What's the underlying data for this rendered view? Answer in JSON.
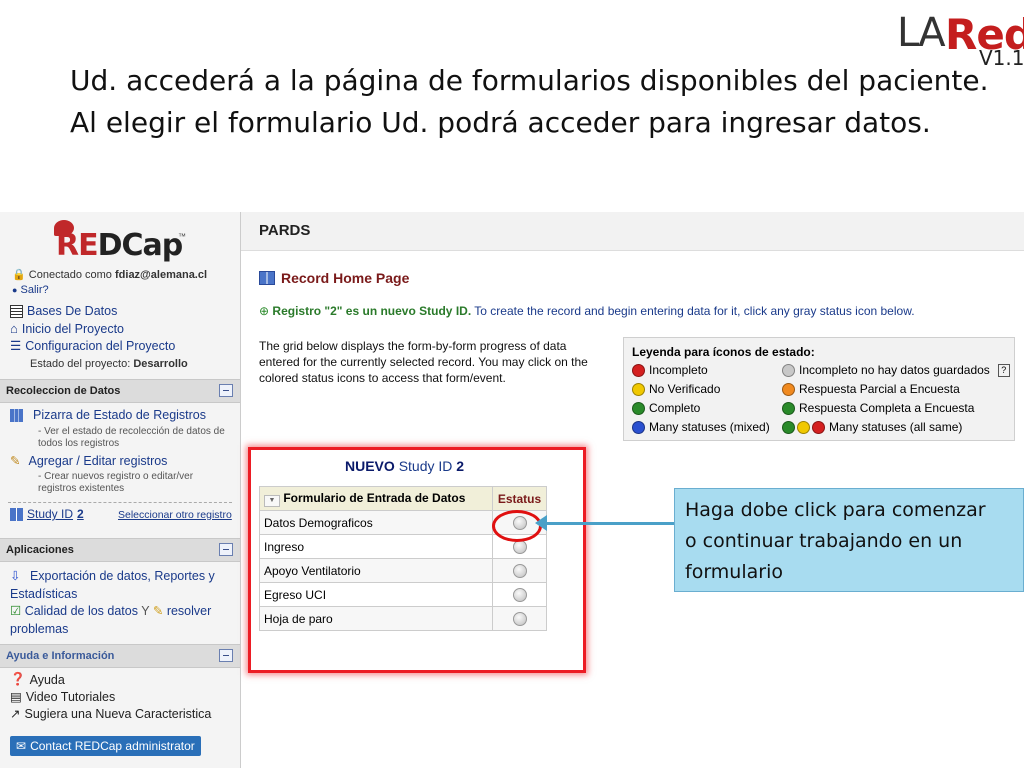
{
  "slide": {
    "title_line1": "Ud. accederá a la página de formularios disponibles del paciente.",
    "title_line2": "Al elegir el formulario Ud. podrá acceder para ingresar datos.",
    "logo_la": "LA",
    "logo_red": "Red",
    "logo_version": "V1.1"
  },
  "sidebar": {
    "logo_text_r": "RE",
    "logo_text_rest": "DCap",
    "logo_tm": "™",
    "connected_as_label": "Conectado como",
    "user": "fdiaz@alemana.cl",
    "logout": "Salir?",
    "links": [
      {
        "label": "Bases De Datos"
      },
      {
        "label": "Inicio del Proyecto"
      },
      {
        "label": "Configuracion del Proyecto"
      }
    ],
    "project_status_label": "Estado del proyecto:",
    "project_status": "Desarrollo",
    "sections": {
      "data_collection": "Recoleccion de Datos",
      "apps": "Aplicaciones",
      "help": "Ayuda e Información"
    },
    "record_status_dashboard": "Pizarra de Estado de Registros",
    "record_status_dashboard_desc": "- Ver el estado de recolección de datos de todos los registros",
    "add_edit_records": "Agregar / Editar registros",
    "add_edit_records_desc": "- Crear nuevos registro o editar/ver registros existentes",
    "study_id_label": "Study ID",
    "study_id_value": "2",
    "select_other_record": "Seleccionar otro registro",
    "apps_export": "Exportación de datos, Reportes y Estadísticas",
    "apps_quality_a": "Calidad de los datos",
    "apps_quality_y": "Y",
    "apps_quality_b": "resolver problemas",
    "help_items": [
      "Ayuda",
      "Video Tutoriales",
      "Sugiera una Nueva Caracteristica"
    ],
    "contact_button": "Contact REDCap administrator"
  },
  "main": {
    "project_title": "PARDS",
    "page_title": "Record Home Page",
    "notice_bold": "Registro \"2\" es un nuevo Study ID.",
    "notice_rest": "To create the record and begin entering data for it, click any gray status icon below.",
    "grid_description": "The grid below displays the form-by-form progress of data entered for the currently selected record. You may click on the colored status icons to access that form/event.",
    "legend": {
      "title": "Leyenda para íconos de estado:",
      "items_left": [
        {
          "label": "Incompleto",
          "color": "#d42020"
        },
        {
          "label": "No Verificado",
          "color": "#f0c800"
        },
        {
          "label": "Completo",
          "color": "#2a8a2a"
        },
        {
          "label": "Many statuses (mixed)",
          "color": "#2a50d0"
        }
      ],
      "items_right": [
        {
          "label": "Incompleto no hay datos guardados",
          "color": "#c8c8c8"
        },
        {
          "label": "Respuesta Parcial a Encuesta",
          "color": "#f08a20"
        },
        {
          "label": "Respuesta Completa a Encuesta",
          "color": "#2a8a2a"
        },
        {
          "label": "Many statuses (all same)",
          "color": "#2a8a2a"
        }
      ],
      "help_mark": "?"
    },
    "new_label": "NUEVO",
    "study_id_label": "Study ID",
    "study_id_value": "2",
    "table": {
      "col_form": "Formulario de Entrada de Datos",
      "col_status": "Estatus",
      "rows": [
        "Datos Demograficos",
        "Ingreso",
        "Apoyo Ventilatorio",
        "Egreso UCI",
        "Hoja de paro"
      ]
    }
  },
  "callout": {
    "line1": "Haga dobe click para comenzar",
    "line2": "o continuar trabajando en un",
    "line3": "formulario"
  },
  "colors": {
    "highlight_red": "#ec1c24",
    "callout_bg": "#a8dcf0",
    "arrow": "#4aa0c8"
  }
}
